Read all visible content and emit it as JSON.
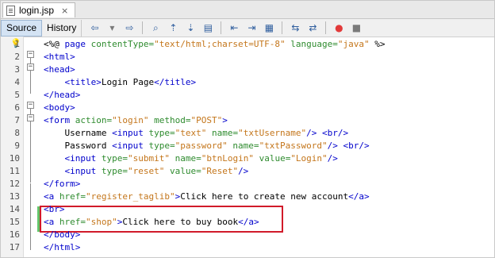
{
  "file_tab": {
    "name": "login.jsp",
    "close": "×"
  },
  "view_tabs": [
    {
      "label": "Source",
      "active": true
    },
    {
      "label": "History",
      "active": false
    }
  ],
  "toolbar_icons": [
    "back-arrow-icon",
    "dropdown-icon",
    "forward-dropdown-icon",
    "search-icon",
    "find-prev-icon",
    "find-next-icon",
    "toggle-highlight-icon",
    "shift-left-icon",
    "shift-right-icon",
    "toggle-comment-icon",
    "uncomment-icon",
    "record-macro-icon",
    "stop-macro-icon"
  ],
  "colors": {
    "tag": "#0000cc",
    "attr": "#2e8b2e",
    "string": "#c4761b",
    "highlight_box": "#d11b2a",
    "change_marker": "#63c46a",
    "toolbar_blue": "#2f5e9e"
  },
  "lines": [
    {
      "n": "1",
      "code": [
        {
          "c": "plain",
          "t": "<%@ "
        },
        {
          "c": "kw",
          "t": "page"
        },
        {
          "c": "attr",
          "t": " contentType="
        },
        {
          "c": "str",
          "t": "\"text/html;charset=UTF-8\""
        },
        {
          "c": "attr",
          "t": " language="
        },
        {
          "c": "str",
          "t": "\"java\""
        },
        {
          "c": "plain",
          "t": " %>"
        }
      ]
    },
    {
      "n": "2",
      "code": [
        {
          "c": "tag",
          "t": "<html>"
        }
      ]
    },
    {
      "n": "3",
      "code": [
        {
          "c": "tag",
          "t": "<head>"
        }
      ]
    },
    {
      "n": "4",
      "code": [
        {
          "c": "plain",
          "t": "    "
        },
        {
          "c": "tag",
          "t": "<title>"
        },
        {
          "c": "plain",
          "t": "Login Page"
        },
        {
          "c": "tag",
          "t": "</title>"
        }
      ]
    },
    {
      "n": "5",
      "code": [
        {
          "c": "tag",
          "t": "</head>"
        }
      ]
    },
    {
      "n": "6",
      "code": [
        {
          "c": "tag",
          "t": "<body>"
        }
      ]
    },
    {
      "n": "7",
      "code": [
        {
          "c": "tag",
          "t": "<form "
        },
        {
          "c": "attr",
          "t": "action="
        },
        {
          "c": "str",
          "t": "\"login\""
        },
        {
          "c": "attr",
          "t": " method="
        },
        {
          "c": "str",
          "t": "\"POST\""
        },
        {
          "c": "tag",
          "t": ">"
        }
      ]
    },
    {
      "n": "8",
      "code": [
        {
          "c": "plain",
          "t": "    Username "
        },
        {
          "c": "tag",
          "t": "<input "
        },
        {
          "c": "attr",
          "t": "type="
        },
        {
          "c": "str",
          "t": "\"text\""
        },
        {
          "c": "attr",
          "t": " name="
        },
        {
          "c": "str",
          "t": "\"txtUsername\""
        },
        {
          "c": "tag",
          "t": "/>"
        },
        {
          "c": "plain",
          "t": " "
        },
        {
          "c": "tag",
          "t": "<br/>"
        }
      ]
    },
    {
      "n": "9",
      "code": [
        {
          "c": "plain",
          "t": "    Password "
        },
        {
          "c": "tag",
          "t": "<input "
        },
        {
          "c": "attr",
          "t": "type="
        },
        {
          "c": "str",
          "t": "\"password\""
        },
        {
          "c": "attr",
          "t": " name="
        },
        {
          "c": "str",
          "t": "\"txtPassword\""
        },
        {
          "c": "tag",
          "t": "/>"
        },
        {
          "c": "plain",
          "t": " "
        },
        {
          "c": "tag",
          "t": "<br/>"
        }
      ]
    },
    {
      "n": "10",
      "code": [
        {
          "c": "plain",
          "t": "    "
        },
        {
          "c": "tag",
          "t": "<input "
        },
        {
          "c": "attr",
          "t": "type="
        },
        {
          "c": "str",
          "t": "\"submit\""
        },
        {
          "c": "attr",
          "t": " name="
        },
        {
          "c": "str",
          "t": "\"btnLogin\""
        },
        {
          "c": "attr",
          "t": " value="
        },
        {
          "c": "str",
          "t": "\"Login\""
        },
        {
          "c": "tag",
          "t": "/>"
        }
      ]
    },
    {
      "n": "11",
      "code": [
        {
          "c": "plain",
          "t": "    "
        },
        {
          "c": "tag",
          "t": "<input "
        },
        {
          "c": "attr",
          "t": "type="
        },
        {
          "c": "str",
          "t": "\"reset\""
        },
        {
          "c": "attr",
          "t": " value="
        },
        {
          "c": "str",
          "t": "\"Reset\""
        },
        {
          "c": "tag",
          "t": "/>"
        }
      ]
    },
    {
      "n": "12",
      "code": [
        {
          "c": "tag",
          "t": "</form>"
        }
      ]
    },
    {
      "n": "13",
      "code": [
        {
          "c": "tag",
          "t": "<a "
        },
        {
          "c": "attr",
          "t": "href="
        },
        {
          "c": "str",
          "t": "\"register_taglib\""
        },
        {
          "c": "tag",
          "t": ">"
        },
        {
          "c": "plain",
          "t": "Click here to create new account"
        },
        {
          "c": "tag",
          "t": "</a>"
        }
      ]
    },
    {
      "n": "14",
      "code": [
        {
          "c": "tag",
          "t": "<br>"
        }
      ]
    },
    {
      "n": "15",
      "code": [
        {
          "c": "tag",
          "t": "<a "
        },
        {
          "c": "attr",
          "t": "href="
        },
        {
          "c": "str",
          "t": "\"shop\""
        },
        {
          "c": "tag",
          "t": ">"
        },
        {
          "c": "plain",
          "t": "Click here to buy book"
        },
        {
          "c": "tag",
          "t": "</a>"
        }
      ]
    },
    {
      "n": "16",
      "code": [
        {
          "c": "tag",
          "t": "</body>"
        }
      ]
    },
    {
      "n": "17",
      "code": [
        {
          "c": "tag",
          "t": "</html>"
        }
      ]
    }
  ]
}
